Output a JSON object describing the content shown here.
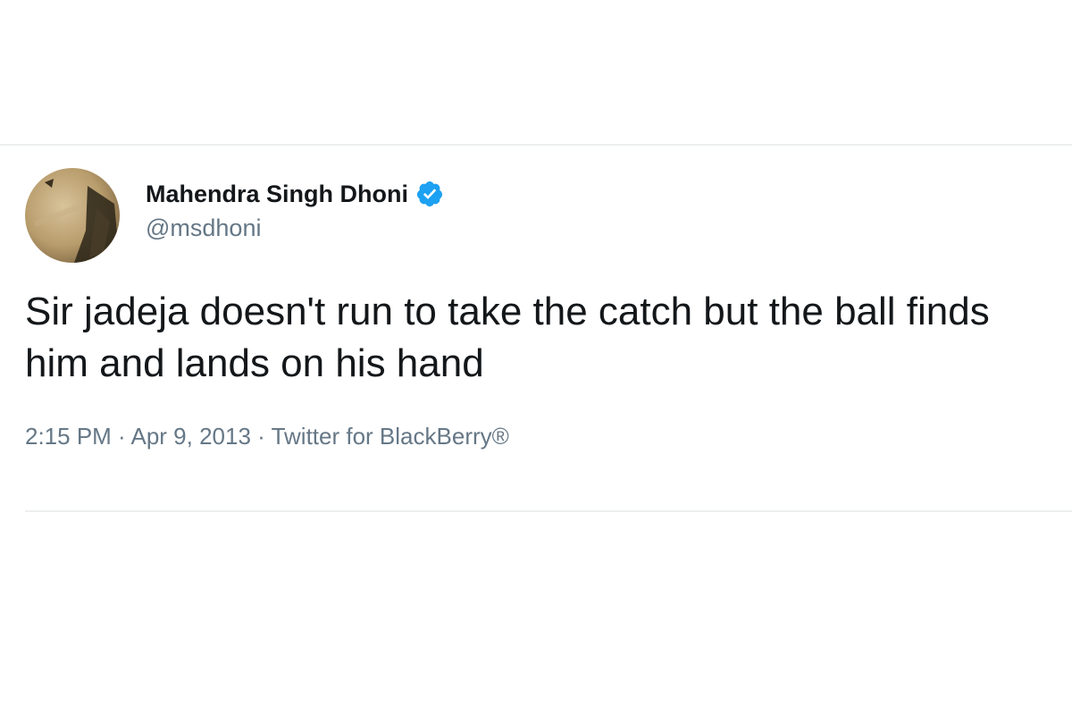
{
  "tweet": {
    "author": {
      "display_name": "Mahendra Singh Dhoni",
      "handle": "@msdhoni",
      "verified": true,
      "avatar_icon": "profile-photo"
    },
    "text": "Sir jadeja doesn't run to take the catch but the ball finds him and lands on his hand",
    "meta": {
      "time": "2:15 PM",
      "separator": " · ",
      "date": "Apr 9, 2013",
      "source": "Twitter for BlackBerry®"
    }
  },
  "colors": {
    "verified_badge": "#1da1f2",
    "primary_text": "#14171a",
    "secondary_text": "#657786",
    "divider": "#eceef0"
  }
}
